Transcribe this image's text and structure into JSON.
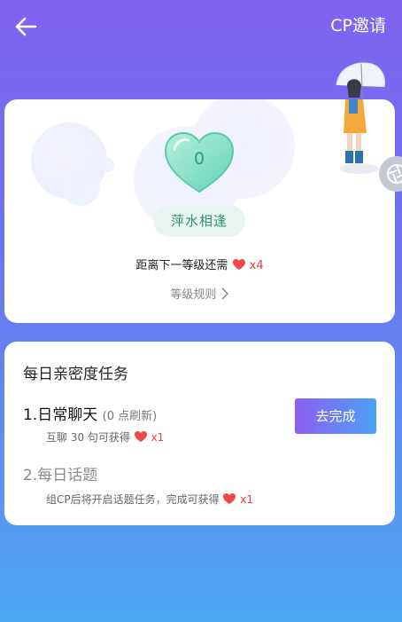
{
  "header": {
    "back_icon": "arrow-left-icon",
    "invite_label": "CP邀请"
  },
  "level_card": {
    "heart_count": "0",
    "level_name": "萍水相逢",
    "progress_text": "距离下一等级还需",
    "progress_multiplier": "x4",
    "rules_label": "等级规则",
    "rules_icon": "chevron-right-icon",
    "heart_color": "#79d9bf"
  },
  "tasks_card": {
    "title": "每日亲密度任务",
    "task1": {
      "title": "1.日常聊天",
      "note": "(0 点刷新)",
      "desc": "互聊 30 句可获得",
      "reward": "x1",
      "button": "去完成"
    },
    "task2": {
      "title": "2.每日话题",
      "desc": "组CP后将开启话题任务，完成可获得",
      "reward": "x1"
    }
  },
  "colors": {
    "accent_red": "#ee3b3b",
    "level_green": "#2e8f73",
    "button_start": "#8c5ef3",
    "button_end": "#4aa2f5"
  }
}
